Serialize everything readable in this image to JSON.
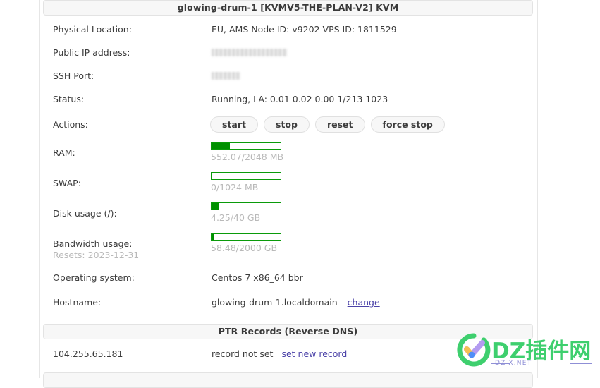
{
  "panel": {
    "header": {
      "hostname": "glowing-drum-1",
      "plan": "[KVMV5-THE-PLAN-V2]",
      "virt": "KVM",
      "full": "glowing-drum-1   [KVMV5-THE-PLAN-V2]   KVM"
    },
    "rows": {
      "physical_location": {
        "label": "Physical Location:",
        "value": "EU, AMS    Node ID: v9202    VPS ID: 1811529",
        "region": "EU, AMS",
        "node_id": "Node ID: v9202",
        "vps_id": "VPS ID: 1811529"
      },
      "public_ip": {
        "label": "Public IP address:",
        "value": "",
        "redacted": true
      },
      "ssh_port": {
        "label": "SSH Port:",
        "value": "",
        "redacted": true
      },
      "status": {
        "label": "Status:",
        "value": "Running, LA: 0.01 0.02 0.00 1/213 1023"
      },
      "actions": {
        "label": "Actions:",
        "buttons": [
          {
            "name": "start",
            "label": "start"
          },
          {
            "name": "stop",
            "label": "stop"
          },
          {
            "name": "reset",
            "label": "reset"
          },
          {
            "name": "force-stop",
            "label": "force stop"
          }
        ]
      },
      "ram": {
        "label": "RAM:",
        "text": "552.07/2048 MB",
        "used": 552.07,
        "total": 2048,
        "unit": "MB",
        "percent": 26.9
      },
      "swap": {
        "label": "SWAP:",
        "text": "0/1024 MB",
        "used": 0,
        "total": 1024,
        "unit": "MB",
        "percent": 0
      },
      "disk": {
        "label": "Disk usage (/):",
        "text": "4.25/40 GB",
        "used": 4.25,
        "total": 40,
        "unit": "GB",
        "percent": 10.6
      },
      "bandwidth": {
        "label": "Bandwidth usage:",
        "sublabel": "Resets: 2023-12-31",
        "text": "58.48/2000 GB",
        "used": 58.48,
        "total": 2000,
        "unit": "GB",
        "percent": 2.9
      },
      "os": {
        "label": "Operating system:",
        "value": "Centos 7 x86_64 bbr"
      },
      "hostname": {
        "label": "Hostname:",
        "value": "glowing-drum-1.localdomain",
        "change_link": "change"
      }
    }
  },
  "ptr": {
    "header": "PTR Records (Reverse DNS)",
    "records": [
      {
        "ip": "104.255.65.181",
        "status": "record not set",
        "action_link": "set new record"
      }
    ]
  },
  "next_panel": {
    "header": ""
  },
  "watermark": {
    "title": "DZ插件网",
    "subtitle": "DZ-X.NET"
  },
  "colors": {
    "meter_border": "#0a9b0a",
    "meter_fill": "#009000",
    "link": "#4b42a8",
    "panel_head_bg": "#f7f7f7",
    "muted_text": "#b9b9b9",
    "watermark_green": "#3ecf6e",
    "watermark_purple": "#8f8fd6"
  }
}
